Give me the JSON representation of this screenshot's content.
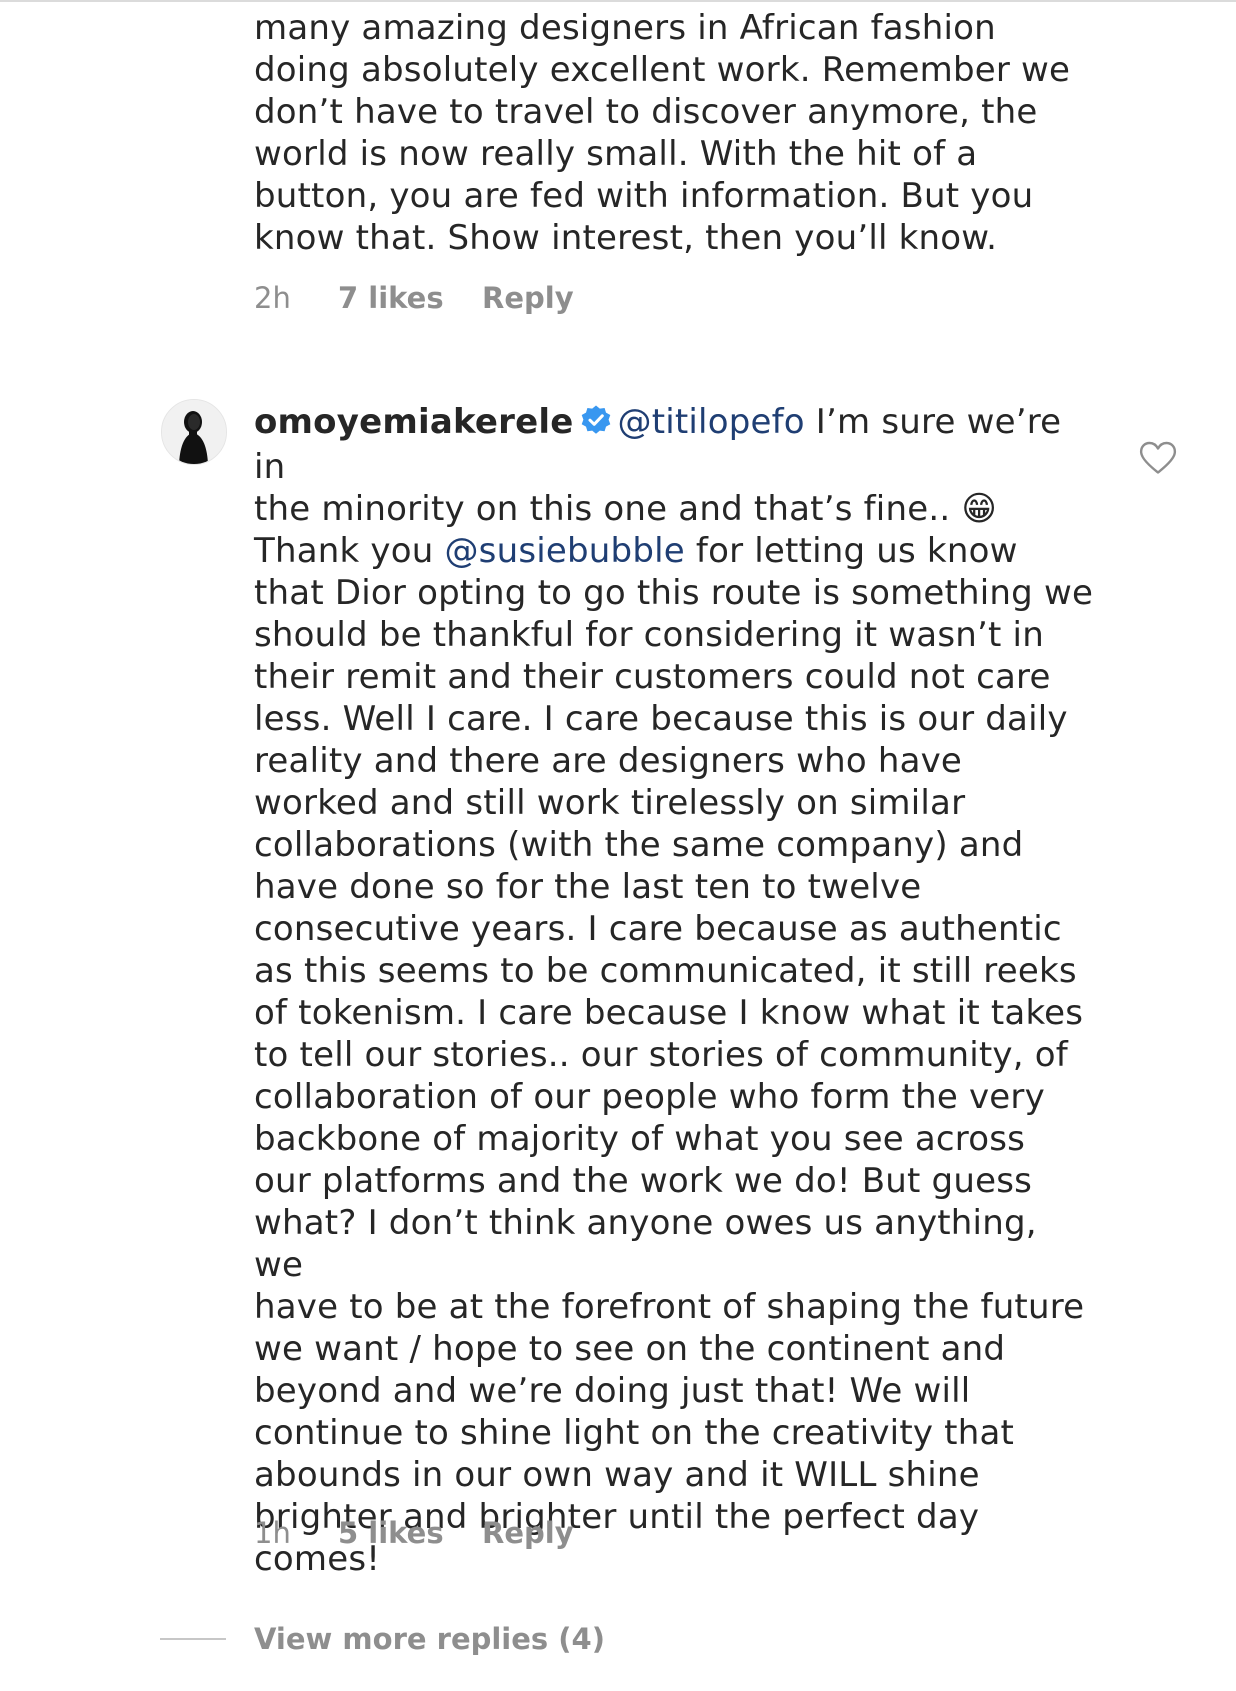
{
  "comment1": {
    "text": "many amazing designers in African fashion\ndoing absolutely excellent work. Remember we\ndon’t have to travel to discover anymore, the\nworld is now really small. With the hit of a\nbutton, you are fed with information. But you\nknow that. Show interest, then you’ll know.",
    "time": "2h",
    "likes": "7 likes",
    "reply_label": "Reply"
  },
  "comment2": {
    "username": "omoyemiakerele",
    "verified_icon": "verified-badge-icon",
    "mention1": "@titilopefo",
    "text_a": " I’m sure we’re in\nthe minority on this one and that’s fine.. ",
    "emoji": "😁",
    "text_b": "\nThank you ",
    "mention2": "@susiebubble",
    "text_c": " for letting us know\nthat Dior opting to go this route is something we\nshould be thankful for considering it wasn’t in\ntheir remit and their customers could not care\nless. Well I care. I care because this is our daily\nreality and there are designers who have\nworked and still work tirelessly on similar\ncollaborations (with the same company) and\nhave done so for the last ten to twelve\nconsecutive years. I care because as authentic\nas this seems to be communicated, it still reeks\nof tokenism. I care because I know what it takes\nto tell our stories.. our stories of community, of\ncollaboration of our people who form the very\nbackbone of majority of what you see across\nour platforms and the work we do! But guess\nwhat? I don’t think anyone owes us anything, we\nhave to be at the forefront of shaping the future\nwe want / hope to see on the continent and\nbeyond and we’re doing just that! We will\ncontinue to shine light on the creativity that\nabounds in our own way and it WILL shine\nbrighter and brighter until the perfect day\ncomes!",
    "time": "1h",
    "likes": "5 likes",
    "reply_label": "Reply",
    "like_icon": "heart-outline-icon"
  },
  "view_more": {
    "label": "View more replies (4)"
  },
  "colors": {
    "text": "#262626",
    "meta": "#8e8e8e",
    "mention": "#1f3e73",
    "verified": "#3897f0",
    "divider": "#c7c7c7"
  }
}
